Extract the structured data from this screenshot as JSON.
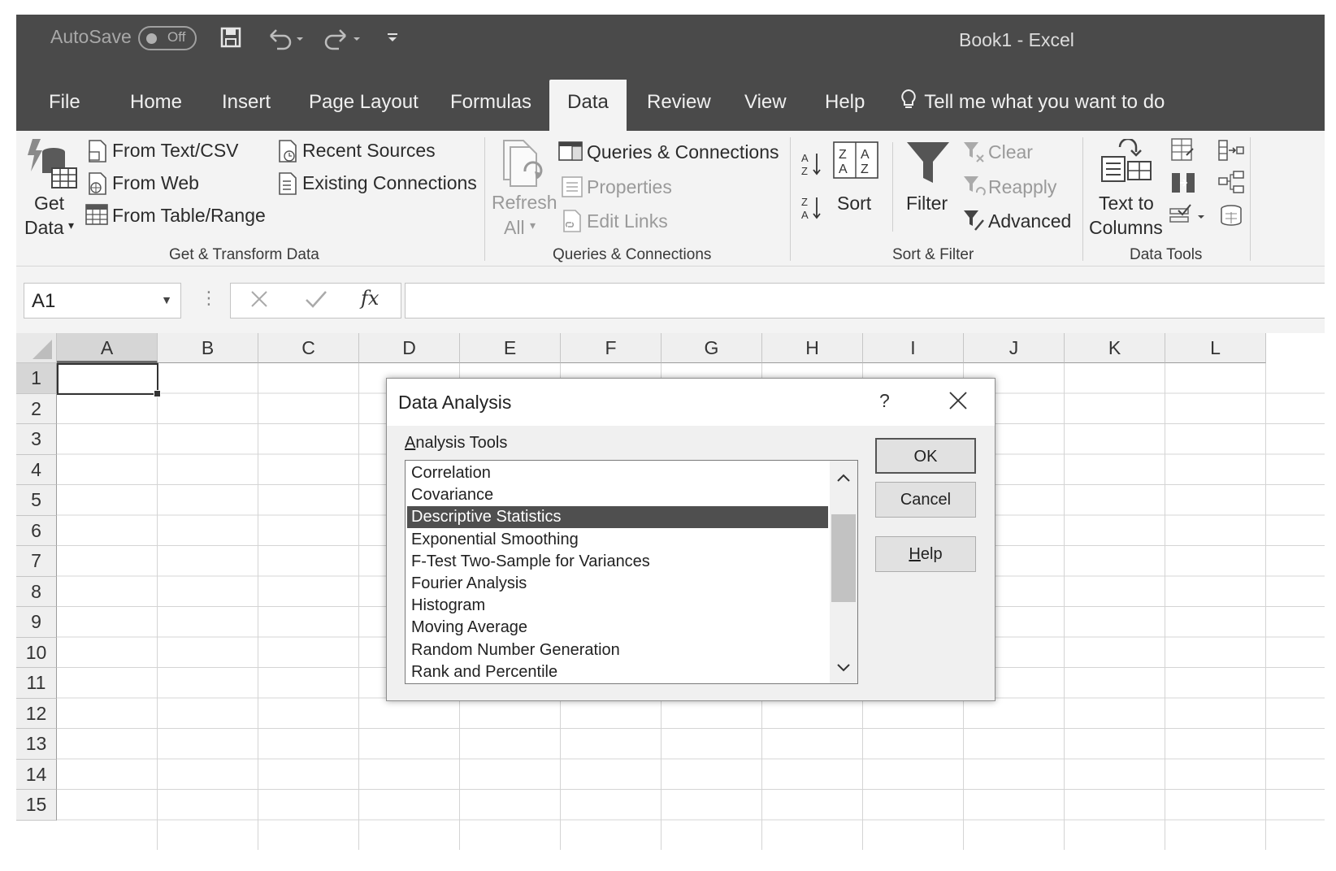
{
  "titlebar": {
    "autosave_label": "AutoSave",
    "autosave_state": "Off",
    "document_title": "Book1  -  Excel"
  },
  "tabs": [
    {
      "label": "File"
    },
    {
      "label": "Home"
    },
    {
      "label": "Insert"
    },
    {
      "label": "Page Layout"
    },
    {
      "label": "Formulas"
    },
    {
      "label": "Data",
      "active": true
    },
    {
      "label": "Review"
    },
    {
      "label": "View"
    },
    {
      "label": "Help"
    }
  ],
  "tell_me": "Tell me what you want to do",
  "ribbon": {
    "get_transform": {
      "get_data_line1": "Get",
      "get_data_line2": "Data",
      "from_text_csv": "From Text/CSV",
      "from_web": "From Web",
      "from_table_range": "From Table/Range",
      "recent_sources": "Recent Sources",
      "existing_connections": "Existing Connections",
      "group_label": "Get & Transform Data"
    },
    "queries": {
      "refresh_line1": "Refresh",
      "refresh_line2": "All",
      "queries_connections": "Queries & Connections",
      "properties": "Properties",
      "edit_links": "Edit Links",
      "group_label": "Queries & Connections"
    },
    "sort_filter": {
      "sort": "Sort",
      "filter": "Filter",
      "clear": "Clear",
      "reapply": "Reapply",
      "advanced": "Advanced",
      "group_label": "Sort & Filter"
    },
    "data_tools": {
      "text_to_line1": "Text to",
      "text_to_line2": "Columns",
      "group_label": "Data Tools"
    }
  },
  "formula_bar": {
    "name_box": "A1",
    "fx": "fx",
    "formula": ""
  },
  "grid": {
    "columns": [
      "A",
      "B",
      "C",
      "D",
      "E",
      "F",
      "G",
      "H",
      "I",
      "J",
      "K",
      "L"
    ],
    "rows": [
      "1",
      "2",
      "3",
      "4",
      "5",
      "6",
      "7",
      "8",
      "9",
      "10",
      "11",
      "12",
      "13",
      "14",
      "15"
    ],
    "active_cell": "A1"
  },
  "dialog": {
    "title": "Data Analysis",
    "help_glyph": "?",
    "tools_label_u": "A",
    "tools_label_rest": "nalysis Tools",
    "items": [
      "Correlation",
      "Covariance",
      "Descriptive Statistics",
      "Exponential Smoothing",
      "F-Test Two-Sample for Variances",
      "Fourier Analysis",
      "Histogram",
      "Moving Average",
      "Random Number Generation",
      "Rank and Percentile"
    ],
    "selected_index": 2,
    "ok": "OK",
    "cancel": "Cancel",
    "help_u": "H",
    "help_rest": "elp"
  },
  "colors": {
    "titlebar": "#4a4a4a",
    "ribbon": "#f3f3f3",
    "selection": "#4f4f4f"
  }
}
